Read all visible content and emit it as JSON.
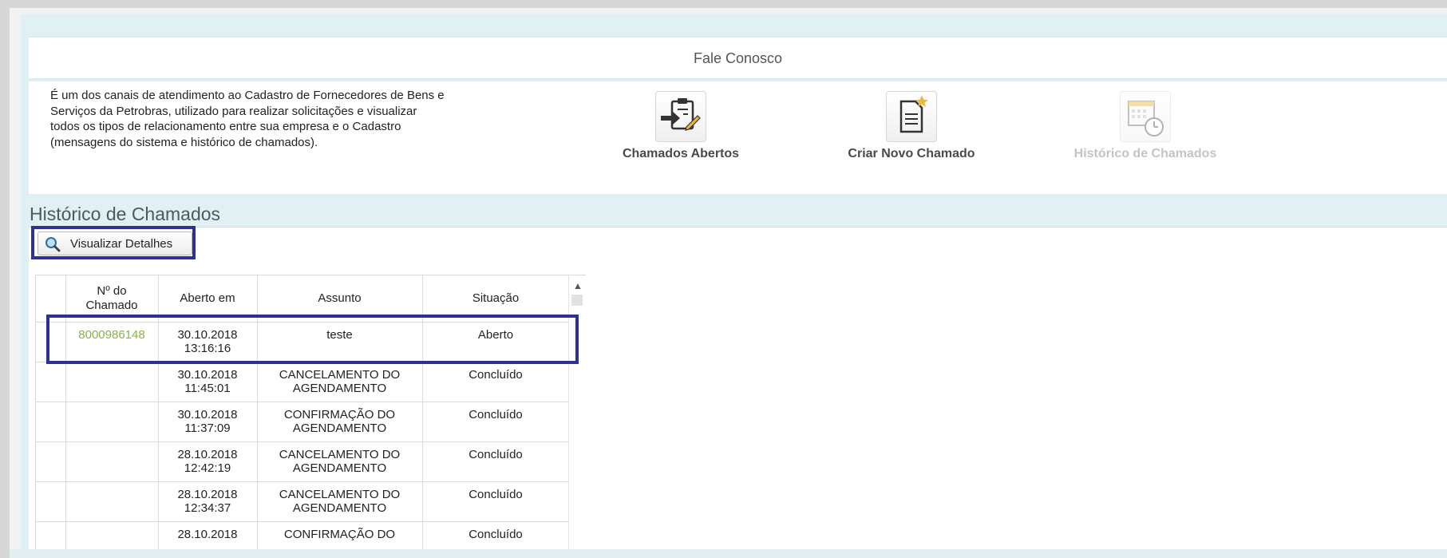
{
  "header": {
    "title": "Fale Conosco"
  },
  "info": {
    "description_lines": [
      "É um dos canais de atendimento ao Cadastro de Fornecedores de Bens e",
      "Serviços da Petrobras, utilizado para realizar solicitações e visualizar",
      "todos os tipos de relacionamento entre sua empresa e o Cadastro",
      "(mensagens do sistema e histórico de chamados)."
    ]
  },
  "actions": [
    {
      "label": "Chamados Abertos",
      "icon": "clipboard-arrow-icon",
      "enabled": true
    },
    {
      "label": "Criar Novo Chamado",
      "icon": "new-document-star-icon",
      "enabled": true
    },
    {
      "label": "Histórico de Chamados",
      "icon": "calendar-clock-icon",
      "enabled": false
    }
  ],
  "section": {
    "title": "Histórico de Chamados",
    "details_button": "Visualizar Detalhes"
  },
  "table": {
    "headers": {
      "number_line1": "Nº do",
      "number_line2": "Chamado",
      "opened": "Aberto em",
      "subject": "Assunto",
      "status": "Situação"
    },
    "rows": [
      {
        "number": "8000986148",
        "date": "30.10.2018",
        "time": "13:16:16",
        "subject1": "teste",
        "subject2": "",
        "status": "Aberto"
      },
      {
        "number": "",
        "date": "30.10.2018",
        "time": "11:45:01",
        "subject1": "CANCELAMENTO DO",
        "subject2": "AGENDAMENTO",
        "status": "Concluído"
      },
      {
        "number": "",
        "date": "30.10.2018",
        "time": "11:37:09",
        "subject1": "CONFIRMAÇÃO DO",
        "subject2": "AGENDAMENTO",
        "status": "Concluído"
      },
      {
        "number": "",
        "date": "28.10.2018",
        "time": "12:42:19",
        "subject1": "CANCELAMENTO DO",
        "subject2": "AGENDAMENTO",
        "status": "Concluído"
      },
      {
        "number": "",
        "date": "28.10.2018",
        "time": "12:34:37",
        "subject1": "CANCELAMENTO DO",
        "subject2": "AGENDAMENTO",
        "status": "Concluído"
      },
      {
        "number": "",
        "date": "28.10.2018",
        "time": "",
        "subject1": "CONFIRMAÇÃO DO",
        "subject2": "",
        "status": "Concluído"
      }
    ]
  },
  "colors": {
    "highlight": "#2e3192",
    "link": "#8ab14a",
    "panel_bg": "#e1f0f3"
  }
}
